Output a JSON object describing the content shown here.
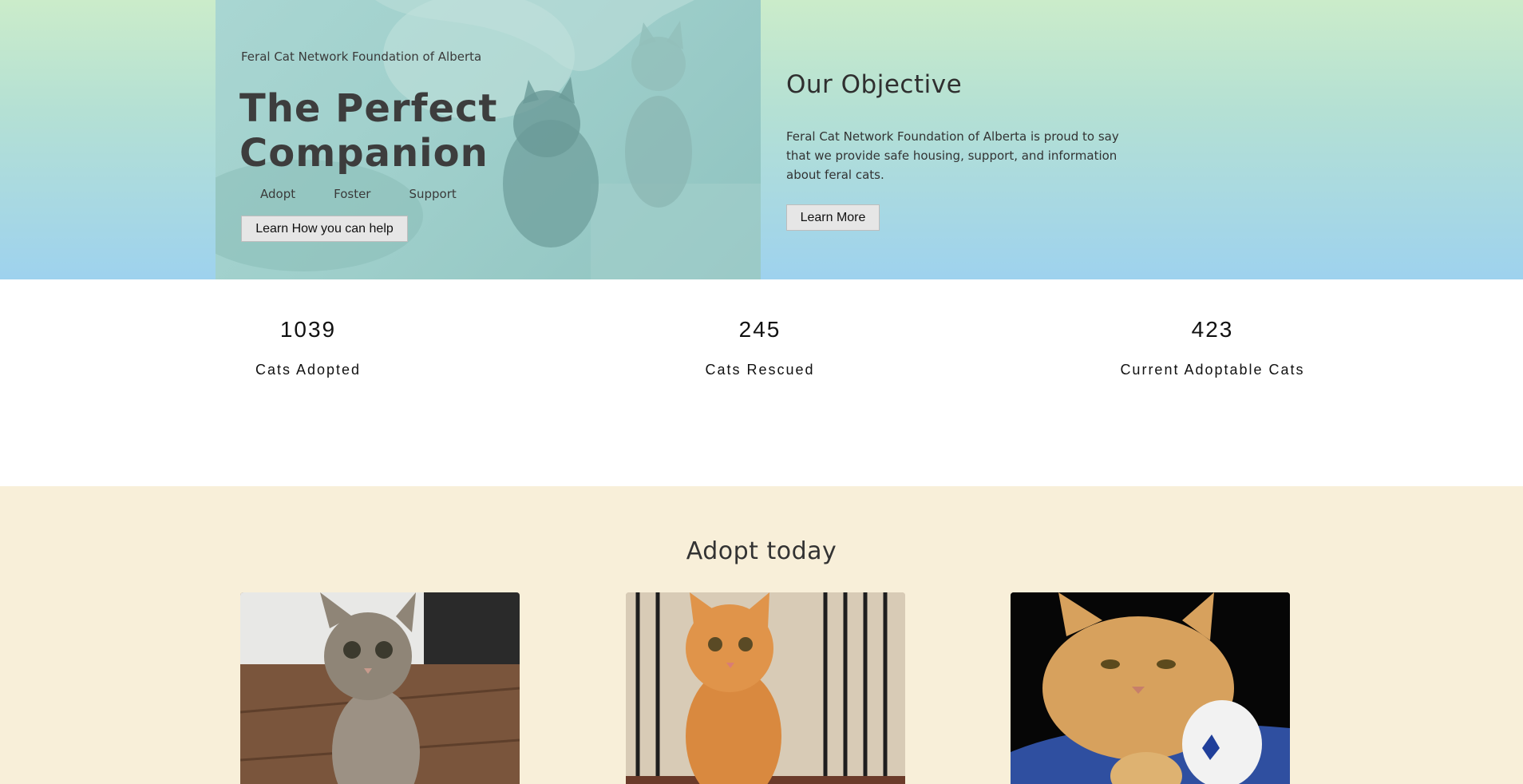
{
  "hero": {
    "org_name": "Feral Cat Network Foundation of Alberta",
    "title": "The Perfect Companion",
    "nav": [
      "Adopt",
      "Foster",
      "Support"
    ],
    "help_button": "Learn How you can help"
  },
  "objective": {
    "title": "Our Objective",
    "text": "Feral Cat Network Foundation of Alberta is proud to say that we provide safe housing, support, and information about feral cats.",
    "button": "Learn More"
  },
  "stats": [
    {
      "value": "1039",
      "label": "Cats Adopted"
    },
    {
      "value": "245",
      "label": "Cats Rescued"
    },
    {
      "value": "423",
      "label": "Current Adoptable Cats"
    }
  ],
  "adopt": {
    "title": "Adopt today",
    "cats": [
      {
        "photo": "tabby-kitten-on-wood-floor"
      },
      {
        "photo": "orange-kitten-in-crate"
      },
      {
        "photo": "orange-cat-in-blue-bed"
      }
    ]
  },
  "colors": {
    "hero_gradient_top": "#cbecca",
    "hero_gradient_bottom": "#9ed2ee",
    "adopt_background": "#f8efd9"
  }
}
